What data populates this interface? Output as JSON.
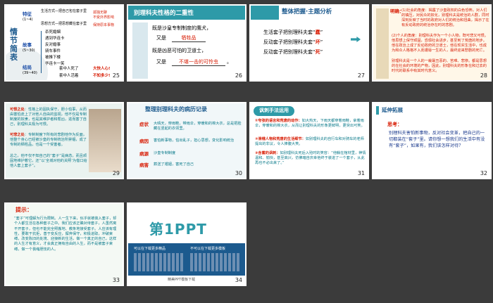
{
  "slides": {
    "s25": {
      "num": "25",
      "vertical_title": "情节简表",
      "groups": [
        {
          "head": "特征",
          "sub": "(1~4)"
        },
        {
          "head": "故事",
          "sub": "(5~30)"
        },
        {
          "head": "结局",
          "sub": "(39~40)"
        }
      ],
      "top_rows": [
        "生活方式—把自己包在套子里",
        "思想方式—把思想藏在套子里"
      ],
      "top_results": [
        "孤独无聊",
        "不受外界影响",
        "保持原本事物"
      ],
      "mid_items": [
        "杀死婚姻",
        "遇到华连卡",
        "反对婚事",
        "骑车事件",
        "被推下楼",
        "华连卡一笑"
      ],
      "end_items": [
        "套中人死了",
        "套中人活着"
      ],
      "end_results": [
        "大快人心!",
        "不知多少!"
      ]
    },
    "s26": {
      "num": "26",
      "title": "别理科夫性格的二重性",
      "intro1": "既是沙皇专制制度的鹰犬，",
      "blank1": "牺牲品",
      "lead1": "又是",
      "intro2": "既是凶恶可怕的卫道士，",
      "blank2": "不堪一击的可怜虫",
      "lead2": "又是",
      "end": "。"
    },
    "s27": {
      "num": "27",
      "title": "整体把握·主题分析",
      "lines": [
        {
          "pre": "生活套子把别理科夫套“",
          "word": "蠢",
          "post": "”"
        },
        {
          "pre": "反动套子把别理科夫套“",
          "word": "坏",
          "post": "”"
        },
        {
          "pre": "反动套子把别理科夫套“",
          "word": "死",
          "post": "”"
        }
      ]
    },
    "s28": {
      "num": "28",
      "label": "明确：",
      "paras": [
        "(1)社会的角度：揭露了沙皇政权的白色恐怖，对人们的镇压，对民众的奴化，别理科夫是统治的人群，同时深刻反映了当时的政府对人们的统治和扭曲，揭示了在有反动政府的统治存在时的悲剧。",
        "(2)个人的角度：别理科夫作为一个小人物，既可悲又可恨。他思想上保守顽固，恐惧社会进步，甚至到了荒唐的地步。他在政治上成了反动政府的卫道士，他在现实生活中，也成为和众人格格不入而遭辱一生的人，最终迎来悲剧的死亡。",
        "别理科夫是一个人的一裁最丑恶的、苦难、悲惨。都是思想的在社会的环境的产物，因此，别理科夫的形象在和过去的时代的联系中有其时代意义。"
      ]
    },
    "s29": {
      "num": "29",
      "p1_label": "可恨之处",
      "p1": "：性格上的固执保守，胆小怕事，从而由害怕走上了对他人自由的监视，他不仅是专制制度的奴隶，也是其维护者和帮凶，进而害了自己，别理科夫极为可恨。",
      "p2_label": "可悲之处",
      "p2": "：专制制度下所有的悲剧他作为反面，他整个身心已经被沙皇的专制统治所禁锢，成了专制的牺牲品，也是一个受害者。",
      "p3": "总之，他不仅不知自己的“套子”是病态，而且顽固地维护着它，还“以‘全城对他的关照’为借口给他人套上套子”。"
    },
    "s30": {
      "num": "30",
      "title": "整理别理科夫的病历记录",
      "rows": [
        {
          "label": "症状",
          "text": "大晴天，穿雨鞋，带雨伞，穿暖和的棉大衣，总是把脸藏在竖起的衣领里。"
        },
        {
          "label": "病因",
          "text": "害怕新事物，怕出乱子，担心思想，变化影响统治"
        },
        {
          "label": "病源",
          "text": "沙皇专制制度"
        },
        {
          "label": "病害",
          "text": "葬送了婚姻，害死了自己"
        }
      ]
    },
    "s31": {
      "num": "31",
      "title": "讽刺手法运用",
      "items": [
        {
          "head": "①夸张的语言和荒唐的动作：",
          "text": "如大热天，下雨天都穿着雨鞋，拿着雨伞，穿暖和的棉大衣，从而让别理科夫的形象更鲜明，更突出可笑。"
        },
        {
          "head": "②滑稽人物和荒唐的生活细节：",
          "text": "如别理科夫的自行车和对骑车的老师提出的非议，令人捧腹大笑。"
        },
        {
          "head": "③含蓄的讽刺：",
          "text": "如别理科夫死后入殓时的笑容：“他躺在棺材里，神情温和、愉快，甚至高兴，仿佛暗自庆幸他终于装进了一个套子，从此再也不必出来了。”"
        }
      ]
    },
    "s32": {
      "num": "32",
      "title": "延伸拓展",
      "label": "思考：",
      "text": "别理科夫害怕新事物，反对社会变革，把自己的一切都装在“套子”里。请你想一想我们的生活中有没有“套子”，如果有，我们该怎样对待？"
    },
    "s33": {
      "num": "33",
      "label": "提示：",
      "text": "“套子”可理解为行为限制。人一生下来，似乎就被装入套子，却个人都生活在各种套子之中。我们应该正确对待套子，人虽然离不开套子，但也不能完全照搬地、教条地接受套子。人应该有理性，要敢于抗拒，善于变反应，摒弃保守，积极进取，冲破束缚，改变陈旧的处境、迎接新的生活，做一个真正的自己，这样的人生才有意义，才会真正拥有自由的人生，而不是被套子束缚，做一个畏缩胆怯的人。"
    },
    "s34": {
      "num": "34",
      "logo_word": "第1PPT",
      "caption_left": "可以在下载更多精品",
      "caption_right": "不可以在下载更多模板",
      "tagline": "精美PPT模板下载"
    }
  },
  "colors": {
    "background": "#3b3b3b",
    "selected_border": "#d9a441",
    "accent_red": "#d81e06",
    "teal_bar": "#2e9aa8"
  }
}
